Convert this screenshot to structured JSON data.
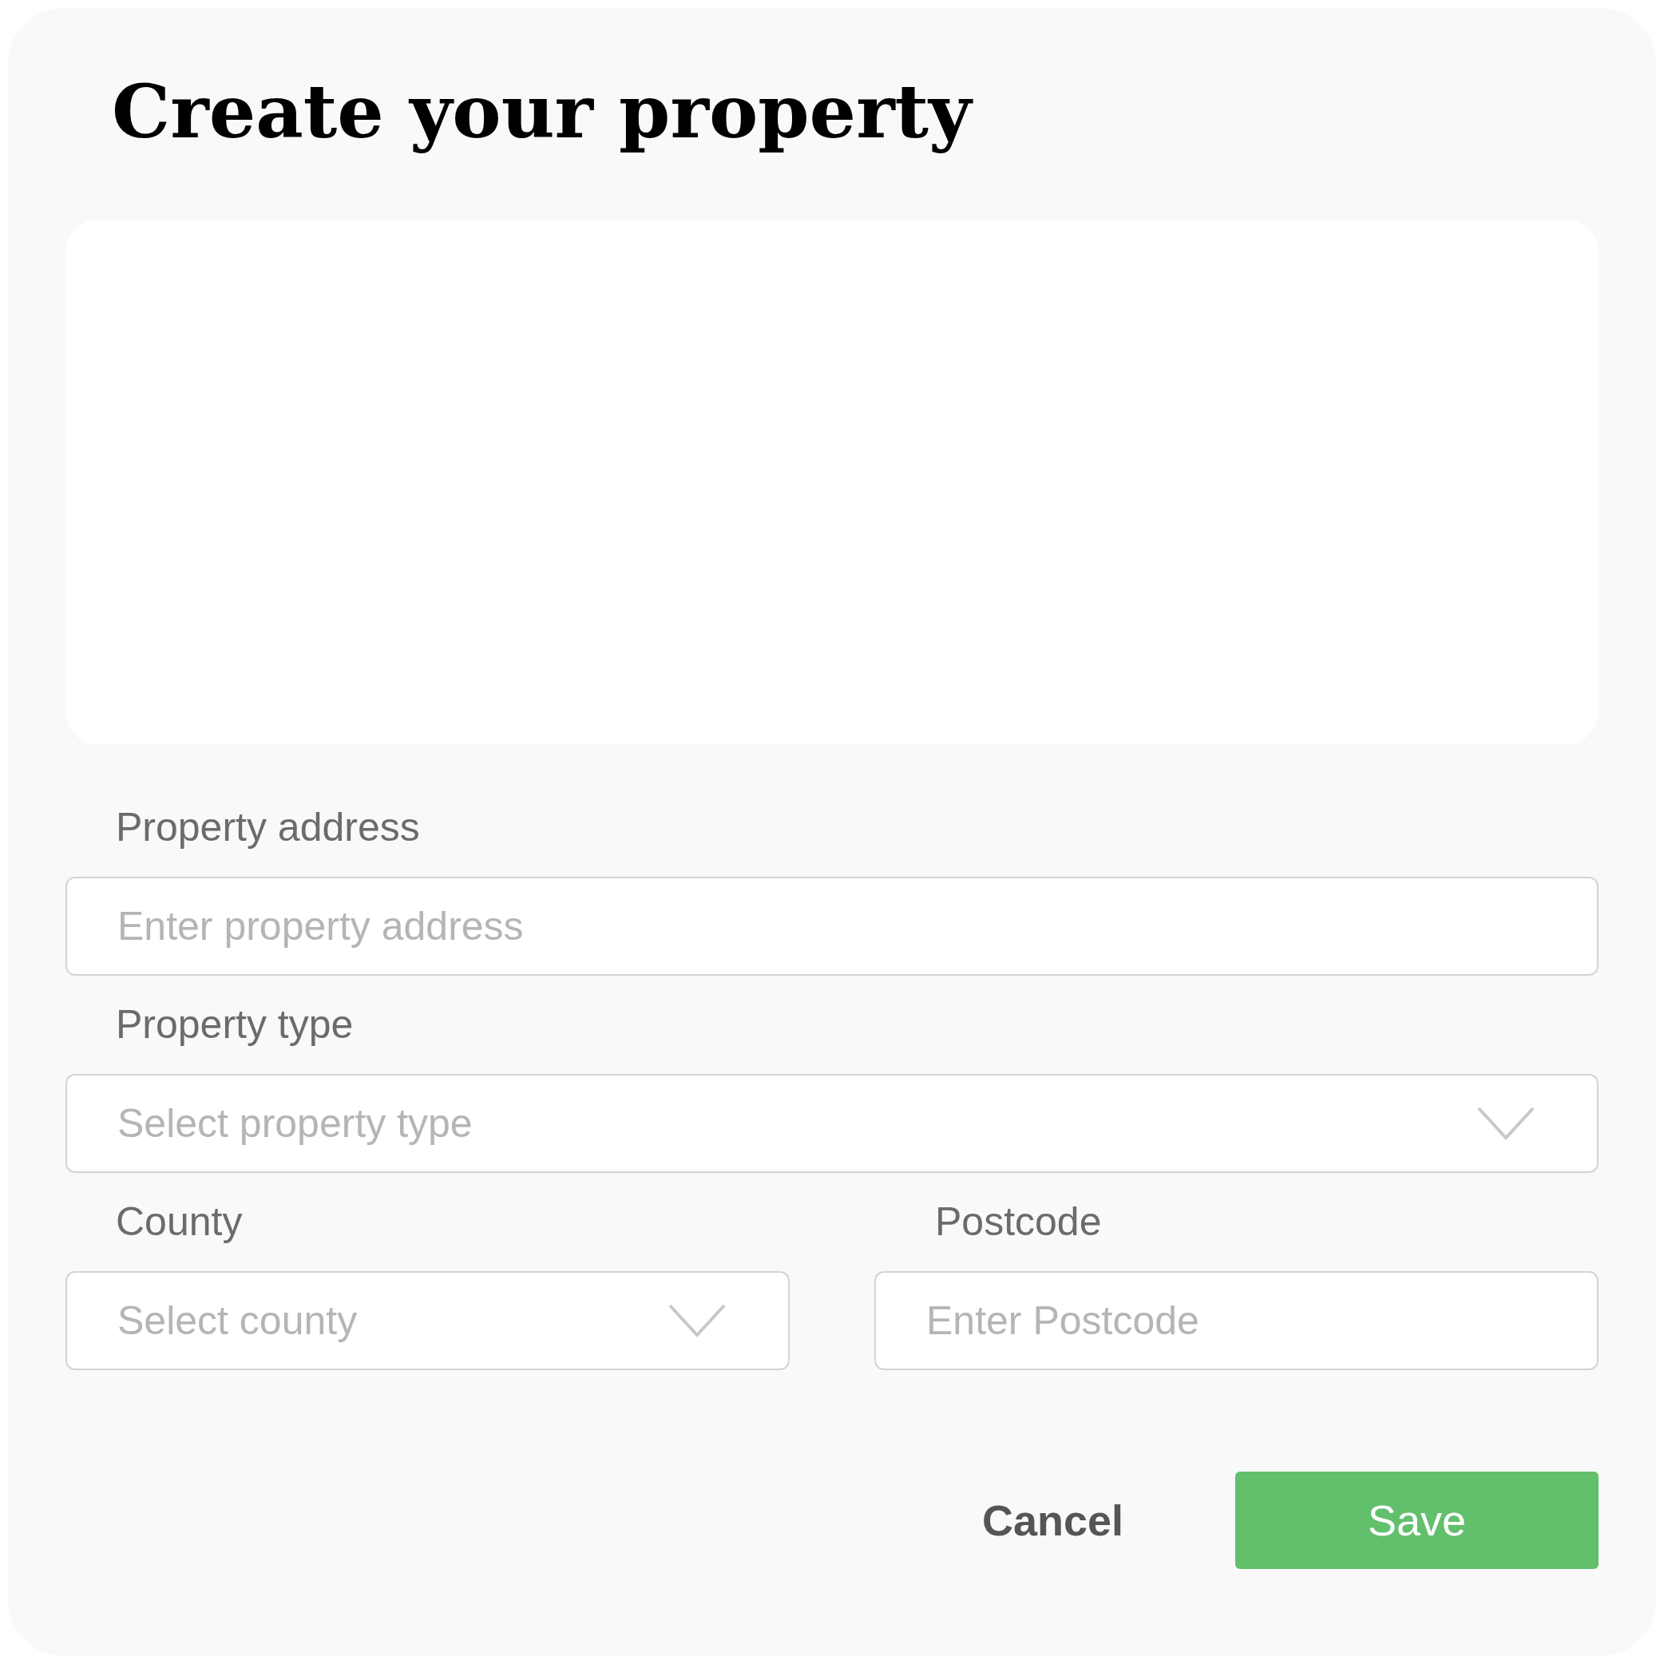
{
  "title": "Create your property",
  "fields": [
    {
      "kind": "text",
      "label": "Property address",
      "placeholder": "Enter property address"
    },
    {
      "kind": "select",
      "label": "Property type",
      "placeholder": "Select property type"
    },
    {
      "kind": "select",
      "label": "County",
      "placeholder": "Select county"
    },
    {
      "kind": "text",
      "label": "Postcode",
      "placeholder": "Enter Postcode"
    }
  ],
  "buttons": [
    {
      "kind": "secondary",
      "label": "Cancel"
    },
    {
      "kind": "primary",
      "label": "Save"
    }
  ]
}
